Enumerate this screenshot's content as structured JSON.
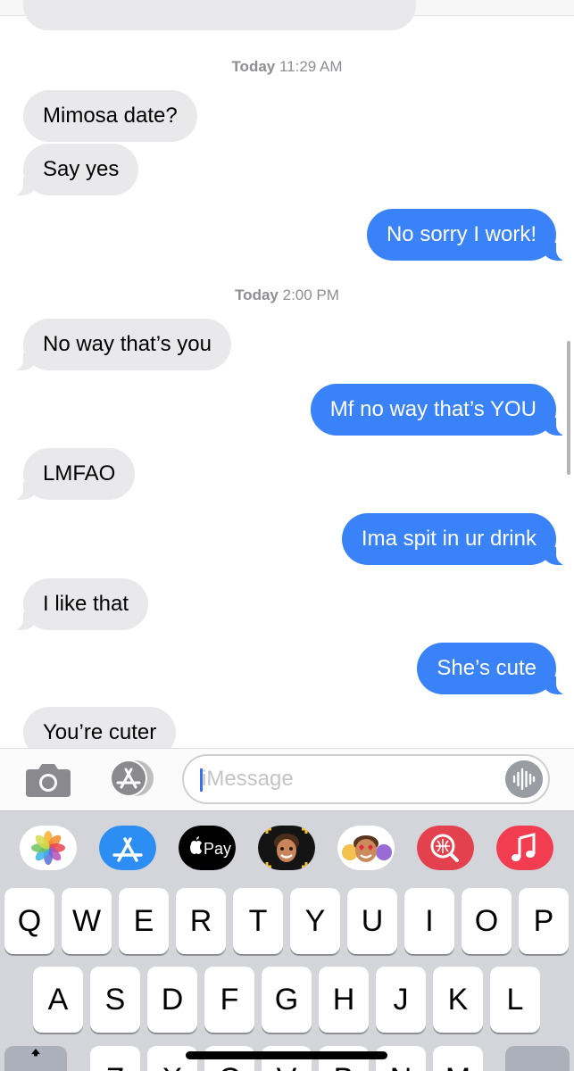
{
  "conversation": {
    "timestamp1": {
      "day": "Today",
      "time": "11:29 AM"
    },
    "timestamp2": {
      "day": "Today",
      "time": "2:00 PM"
    },
    "messages": [
      {
        "text": "Mimosa date?"
      },
      {
        "text": "Say yes"
      },
      {
        "text": "No sorry I work!"
      },
      {
        "text": "No way that’s you"
      },
      {
        "text": "Mf no way that’s YOU"
      },
      {
        "text": "LMFAO"
      },
      {
        "text": "Ima spit in ur drink"
      },
      {
        "text": "I like that"
      },
      {
        "text": "She’s cute"
      },
      {
        "text": "You’re cuter"
      }
    ],
    "colors": {
      "incoming": "#e9e9eb",
      "outgoing": "#3a82f7"
    }
  },
  "input": {
    "placeholder": "iMessage"
  },
  "icons": {
    "camera": "camera-icon",
    "app_store": "app-store-icon",
    "audio": "waveform-icon"
  },
  "apps": [
    {
      "name": "Photos"
    },
    {
      "name": "App Store"
    },
    {
      "name": "Apple Pay",
      "label": "Pay"
    },
    {
      "name": "Memoji Stickers"
    },
    {
      "name": "Animoji"
    },
    {
      "name": "Images Search"
    },
    {
      "name": "Music"
    }
  ],
  "keyboard": {
    "row1": [
      "Q",
      "W",
      "E",
      "R",
      "T",
      "Y",
      "U",
      "I",
      "O",
      "P"
    ],
    "row2": [
      "A",
      "S",
      "D",
      "F",
      "G",
      "H",
      "J",
      "K",
      "L"
    ],
    "row3": [
      "Z",
      "X",
      "C",
      "V",
      "B",
      "N",
      "M"
    ]
  }
}
